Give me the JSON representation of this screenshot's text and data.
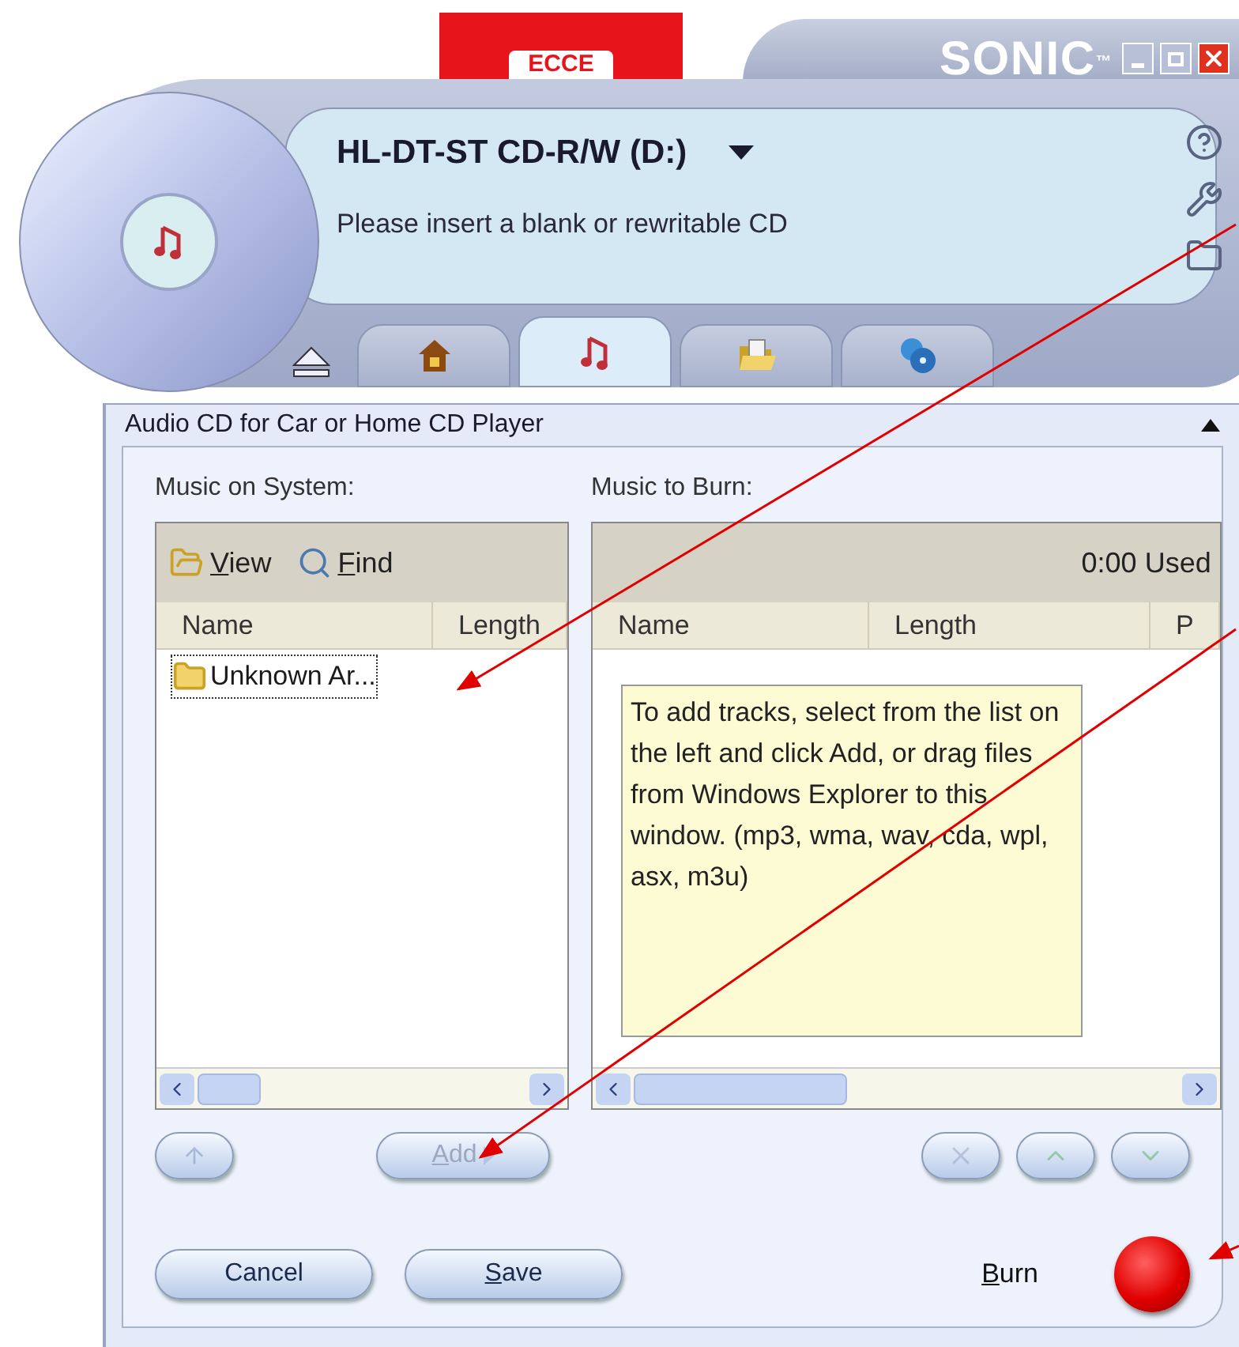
{
  "logo": {
    "text": "ECCE"
  },
  "brand": {
    "text": "SONIC",
    "mark": "™"
  },
  "drive": {
    "name": "HL-DT-ST CD-R/W (D:)",
    "message": "Please insert a blank or rewritable CD"
  },
  "tabs": [
    {
      "kind": "home",
      "selected": false
    },
    {
      "kind": "music",
      "selected": true
    },
    {
      "kind": "folder",
      "selected": false
    },
    {
      "kind": "copy",
      "selected": false
    }
  ],
  "panel": {
    "title": "Audio CD for Car or Home CD Player"
  },
  "system": {
    "label": "Music on System:",
    "tools": [
      {
        "kind": "view",
        "label": "View"
      },
      {
        "kind": "find",
        "label": "Find"
      }
    ],
    "columns": [
      "Name",
      "Length"
    ],
    "items": [
      {
        "name": "Unknown Ar...",
        "focused": true
      }
    ]
  },
  "burn_list": {
    "label": "Music to Burn:",
    "used": "0:00 Used",
    "columns": [
      "Name",
      "Length",
      "P"
    ],
    "hint": "To add tracks, select from the list on the left and click Add, or drag files from Windows Explorer to this window. (mp3, wma, wav, cda, wpl, asx, m3u)"
  },
  "list_buttons": [
    {
      "kind": "up",
      "disabled": true
    },
    {
      "kind": "add",
      "label": "Add",
      "disabled": true
    },
    {
      "kind": "remove",
      "disabled": true
    },
    {
      "kind": "move_up",
      "disabled": true
    },
    {
      "kind": "move_down",
      "disabled": true
    }
  ],
  "actions": [
    {
      "label": "Cancel",
      "accel": false
    },
    {
      "label": "Save",
      "accel": true
    }
  ],
  "burn": {
    "label": "Burn"
  }
}
